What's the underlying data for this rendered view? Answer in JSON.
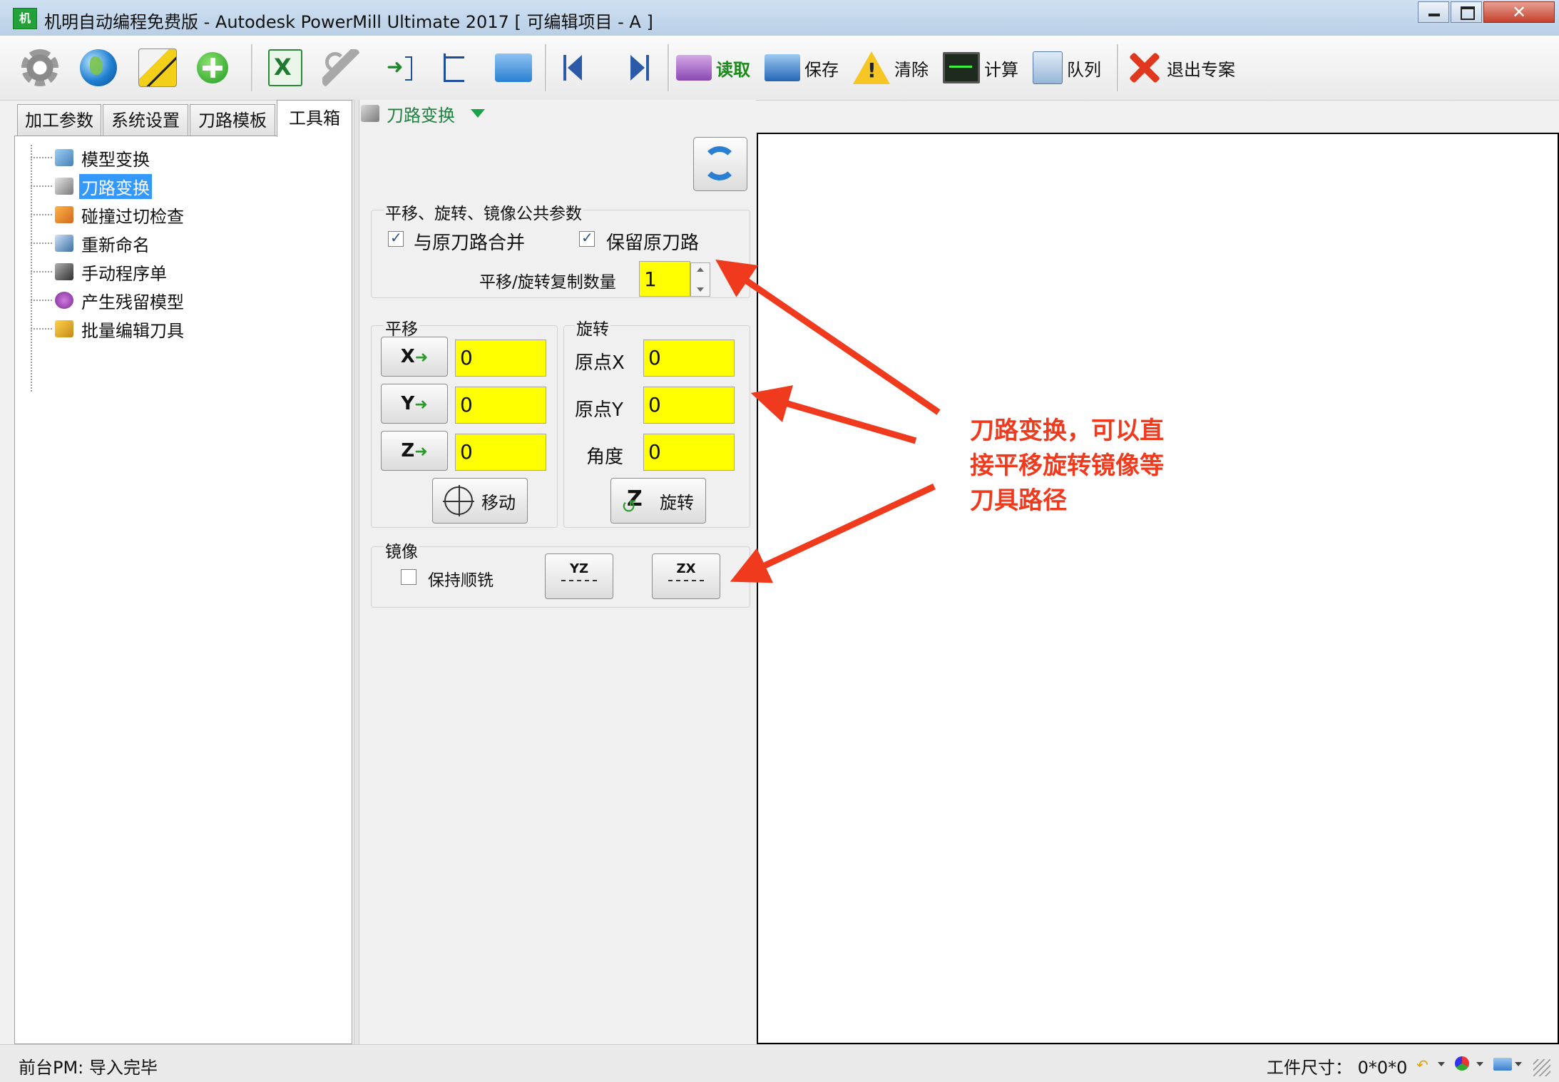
{
  "window": {
    "title": "机明自动编程免费版 - Autodesk PowerMill Ultimate 2017   [ 可编辑项目 - A ]",
    "app_icon_text": "机"
  },
  "toolbar": {
    "read_label": "读取",
    "save_label": "保存",
    "clear_label": "清除",
    "calc_label": "计算",
    "queue_label": "队列",
    "exit_label": "退出专案"
  },
  "left_tabs": [
    "加工参数",
    "系统设置",
    "刀路模板",
    "工具箱"
  ],
  "active_tab": "工具箱",
  "tree": [
    {
      "label": "模型变换",
      "icon": "model-transform-icon"
    },
    {
      "label": "刀路变换",
      "icon": "toolpath-transform-icon"
    },
    {
      "label": "碰撞过切检查",
      "icon": "collision-check-icon"
    },
    {
      "label": "重新命名",
      "icon": "rename-icon"
    },
    {
      "label": "手动程序单",
      "icon": "program-sheet-icon"
    },
    {
      "label": "产生残留模型",
      "icon": "stock-model-icon"
    },
    {
      "label": "批量编辑刀具",
      "icon": "batch-tool-edit-icon"
    }
  ],
  "selected_tree_item": "刀路变换",
  "panel": {
    "header": "刀路变换",
    "common": {
      "title": "平移、旋转、镜像公共参数",
      "merge_label": "与原刀路合并",
      "merge_checked": true,
      "keep_label": "保留原刀路",
      "keep_checked": true,
      "copies_label": "平移/旋转复制数量",
      "copies_value": "1"
    },
    "translate": {
      "title": "平移",
      "x_btn": "X",
      "y_btn": "Y",
      "z_btn": "Z",
      "x_value": "0",
      "y_value": "0",
      "z_value": "0",
      "move_label": "移动"
    },
    "rotate": {
      "title": "旋转",
      "origin_x_label": "原点X",
      "origin_y_label": "原点Y",
      "angle_label": "角度",
      "origin_x_value": "0",
      "origin_y_value": "0",
      "angle_value": "0",
      "rotate_label": "旋转"
    },
    "mirror": {
      "title": "镜像",
      "keep_climb_label": "保持顺铣",
      "keep_climb_checked": false,
      "yz_label": "YZ",
      "zx_label": "ZX"
    }
  },
  "annotation": {
    "line1": "刀路变换，可以直",
    "line2": "接平移旋转镜像等",
    "line3": "刀具路径",
    "color": "#f03a1e"
  },
  "status": {
    "left": "前台PM: 导入完毕",
    "size_label": "工件尺寸：",
    "size_value": "0*0*0"
  }
}
